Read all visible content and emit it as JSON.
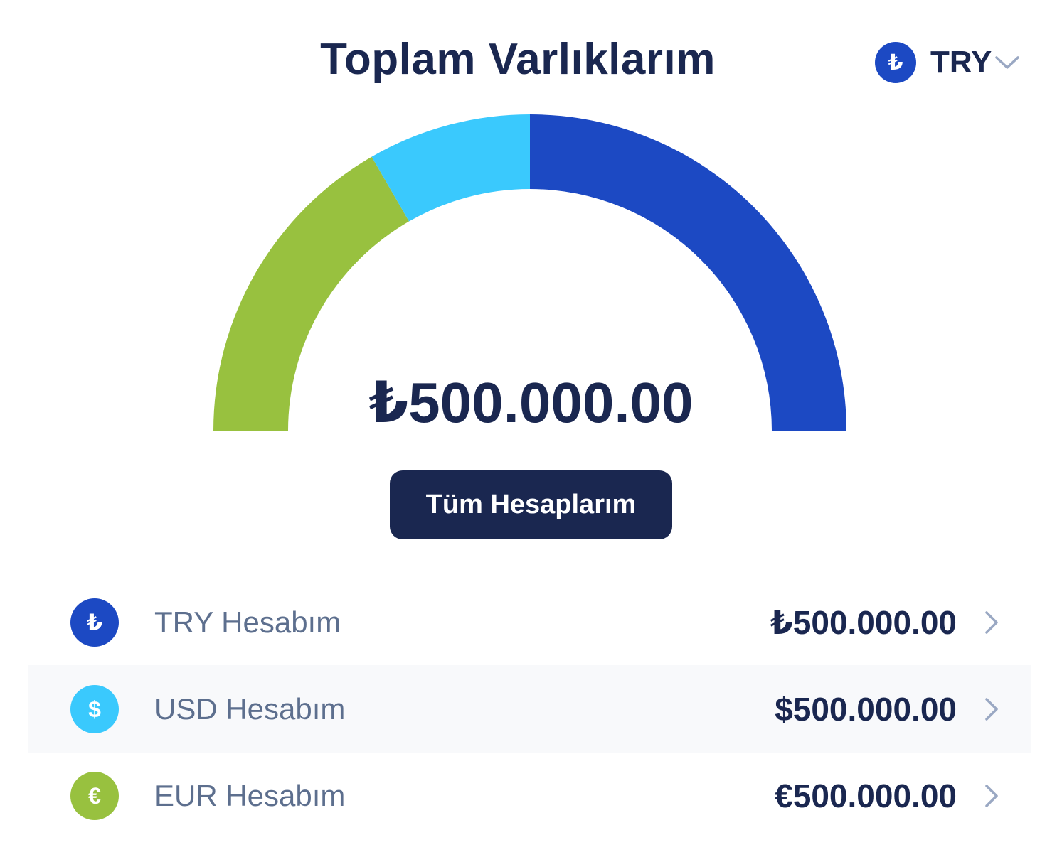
{
  "header": {
    "title": "Toplam Varlıklarım",
    "currency_code": "TRY",
    "currency_symbol": "₺"
  },
  "summary": {
    "total": "₺500.000.00",
    "all_accounts_label": "Tüm Hesaplarım"
  },
  "chart_data": {
    "type": "pie",
    "style": "half-donut",
    "series": [
      {
        "color": "#98c13f",
        "value": 2
      },
      {
        "color": "#3ac9fd",
        "value": 1
      },
      {
        "color": "#1c49c3",
        "value": 3
      }
    ]
  },
  "accounts": [
    {
      "symbol": "₺",
      "name": "TRY Hesabım",
      "amount": "₺500.000.00",
      "color": "#1c49c3",
      "icon": "lira-icon"
    },
    {
      "symbol": "$",
      "name": "USD Hesabım",
      "amount": "$500.000.00",
      "color": "#3ac9fd",
      "icon": "dollar-icon"
    },
    {
      "symbol": "€",
      "name": "EUR Hesabım",
      "amount": "€500.000.00",
      "color": "#98c13f",
      "icon": "euro-icon"
    }
  ],
  "icons": {
    "chevron": "chevron-down-icon",
    "row_arrow": "chevron-right-icon"
  }
}
